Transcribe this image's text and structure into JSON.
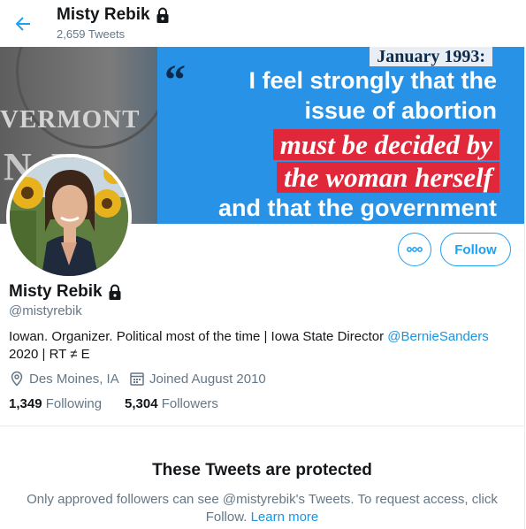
{
  "header": {
    "back_icon": "arrow-left-icon",
    "name": "Misty Rebik",
    "tweet_count": "2,659 Tweets"
  },
  "banner": {
    "date": "January 1993:",
    "quote_mark": "“",
    "line1": "I feel strongly that the",
    "line2": "issue of abortion",
    "red1": "must be decided by",
    "red2": "the woman herself",
    "line3": "and that the government",
    "plate_state": "VERMONT",
    "plate_code": "N  V."
  },
  "actions": {
    "more_icon": "more-options-icon",
    "follow_label": "Follow"
  },
  "profile": {
    "name": "Misty Rebik",
    "lock_icon": "lock-icon",
    "handle": "@mistyrebik",
    "bio_prefix": "Iowan. Organizer. Political most of the time | Iowa State Director ",
    "bio_link": "@BernieSanders",
    "bio_suffix": "2020 | RT ≠ E",
    "location": "Des Moines, IA",
    "joined": "Joined August 2010",
    "following_count": "1,349",
    "following_label": "Following",
    "followers_count": "5,304",
    "followers_label": "Followers"
  },
  "protected": {
    "title": "These Tweets are protected",
    "text": "Only approved followers can see @mistyrebik's Tweets. To request access, click Follow.",
    "learn_more": "Learn more"
  },
  "colors": {
    "accent": "#1da1f2",
    "link": "#1b95e0",
    "secondary_text": "#657786",
    "banner_blue": "#2892e6",
    "banner_red": "#e0283a"
  }
}
